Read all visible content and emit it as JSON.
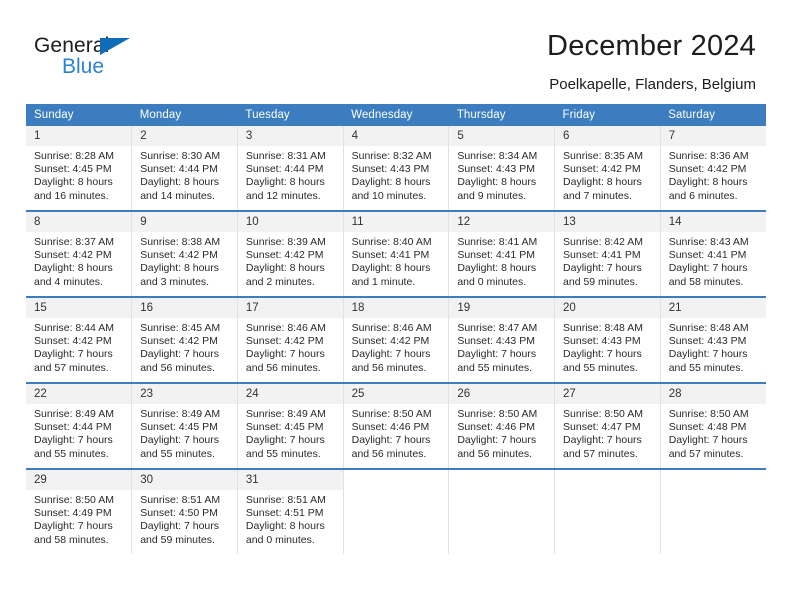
{
  "logo": {
    "text_primary": "General",
    "text_secondary": "Blue",
    "color_primary": "#1d1d1b",
    "color_secondary": "#2b82d4",
    "triangle_color": "#0f6cb8"
  },
  "header": {
    "title": "December 2024",
    "subtitle": "Poelkapelle, Flanders, Belgium"
  },
  "theme": {
    "header_bg": "#3b7dbf",
    "header_text": "#ffffff",
    "daynum_bg": "#f2f2f2",
    "cell_bg": "#ffffff",
    "text": "#2a2a2a"
  },
  "calendar": {
    "weekday_headers": [
      "Sunday",
      "Monday",
      "Tuesday",
      "Wednesday",
      "Thursday",
      "Friday",
      "Saturday"
    ],
    "weeks": [
      [
        {
          "day": "1",
          "sunrise": "Sunrise: 8:28 AM",
          "sunset": "Sunset: 4:45 PM",
          "daylight1": "Daylight: 8 hours",
          "daylight2": "and 16 minutes."
        },
        {
          "day": "2",
          "sunrise": "Sunrise: 8:30 AM",
          "sunset": "Sunset: 4:44 PM",
          "daylight1": "Daylight: 8 hours",
          "daylight2": "and 14 minutes."
        },
        {
          "day": "3",
          "sunrise": "Sunrise: 8:31 AM",
          "sunset": "Sunset: 4:44 PM",
          "daylight1": "Daylight: 8 hours",
          "daylight2": "and 12 minutes."
        },
        {
          "day": "4",
          "sunrise": "Sunrise: 8:32 AM",
          "sunset": "Sunset: 4:43 PM",
          "daylight1": "Daylight: 8 hours",
          "daylight2": "and 10 minutes."
        },
        {
          "day": "5",
          "sunrise": "Sunrise: 8:34 AM",
          "sunset": "Sunset: 4:43 PM",
          "daylight1": "Daylight: 8 hours",
          "daylight2": "and 9 minutes."
        },
        {
          "day": "6",
          "sunrise": "Sunrise: 8:35 AM",
          "sunset": "Sunset: 4:42 PM",
          "daylight1": "Daylight: 8 hours",
          "daylight2": "and 7 minutes."
        },
        {
          "day": "7",
          "sunrise": "Sunrise: 8:36 AM",
          "sunset": "Sunset: 4:42 PM",
          "daylight1": "Daylight: 8 hours",
          "daylight2": "and 6 minutes."
        }
      ],
      [
        {
          "day": "8",
          "sunrise": "Sunrise: 8:37 AM",
          "sunset": "Sunset: 4:42 PM",
          "daylight1": "Daylight: 8 hours",
          "daylight2": "and 4 minutes."
        },
        {
          "day": "9",
          "sunrise": "Sunrise: 8:38 AM",
          "sunset": "Sunset: 4:42 PM",
          "daylight1": "Daylight: 8 hours",
          "daylight2": "and 3 minutes."
        },
        {
          "day": "10",
          "sunrise": "Sunrise: 8:39 AM",
          "sunset": "Sunset: 4:42 PM",
          "daylight1": "Daylight: 8 hours",
          "daylight2": "and 2 minutes."
        },
        {
          "day": "11",
          "sunrise": "Sunrise: 8:40 AM",
          "sunset": "Sunset: 4:41 PM",
          "daylight1": "Daylight: 8 hours",
          "daylight2": "and 1 minute."
        },
        {
          "day": "12",
          "sunrise": "Sunrise: 8:41 AM",
          "sunset": "Sunset: 4:41 PM",
          "daylight1": "Daylight: 8 hours",
          "daylight2": "and 0 minutes."
        },
        {
          "day": "13",
          "sunrise": "Sunrise: 8:42 AM",
          "sunset": "Sunset: 4:41 PM",
          "daylight1": "Daylight: 7 hours",
          "daylight2": "and 59 minutes."
        },
        {
          "day": "14",
          "sunrise": "Sunrise: 8:43 AM",
          "sunset": "Sunset: 4:41 PM",
          "daylight1": "Daylight: 7 hours",
          "daylight2": "and 58 minutes."
        }
      ],
      [
        {
          "day": "15",
          "sunrise": "Sunrise: 8:44 AM",
          "sunset": "Sunset: 4:42 PM",
          "daylight1": "Daylight: 7 hours",
          "daylight2": "and 57 minutes."
        },
        {
          "day": "16",
          "sunrise": "Sunrise: 8:45 AM",
          "sunset": "Sunset: 4:42 PM",
          "daylight1": "Daylight: 7 hours",
          "daylight2": "and 56 minutes."
        },
        {
          "day": "17",
          "sunrise": "Sunrise: 8:46 AM",
          "sunset": "Sunset: 4:42 PM",
          "daylight1": "Daylight: 7 hours",
          "daylight2": "and 56 minutes."
        },
        {
          "day": "18",
          "sunrise": "Sunrise: 8:46 AM",
          "sunset": "Sunset: 4:42 PM",
          "daylight1": "Daylight: 7 hours",
          "daylight2": "and 56 minutes."
        },
        {
          "day": "19",
          "sunrise": "Sunrise: 8:47 AM",
          "sunset": "Sunset: 4:43 PM",
          "daylight1": "Daylight: 7 hours",
          "daylight2": "and 55 minutes."
        },
        {
          "day": "20",
          "sunrise": "Sunrise: 8:48 AM",
          "sunset": "Sunset: 4:43 PM",
          "daylight1": "Daylight: 7 hours",
          "daylight2": "and 55 minutes."
        },
        {
          "day": "21",
          "sunrise": "Sunrise: 8:48 AM",
          "sunset": "Sunset: 4:43 PM",
          "daylight1": "Daylight: 7 hours",
          "daylight2": "and 55 minutes."
        }
      ],
      [
        {
          "day": "22",
          "sunrise": "Sunrise: 8:49 AM",
          "sunset": "Sunset: 4:44 PM",
          "daylight1": "Daylight: 7 hours",
          "daylight2": "and 55 minutes."
        },
        {
          "day": "23",
          "sunrise": "Sunrise: 8:49 AM",
          "sunset": "Sunset: 4:45 PM",
          "daylight1": "Daylight: 7 hours",
          "daylight2": "and 55 minutes."
        },
        {
          "day": "24",
          "sunrise": "Sunrise: 8:49 AM",
          "sunset": "Sunset: 4:45 PM",
          "daylight1": "Daylight: 7 hours",
          "daylight2": "and 55 minutes."
        },
        {
          "day": "25",
          "sunrise": "Sunrise: 8:50 AM",
          "sunset": "Sunset: 4:46 PM",
          "daylight1": "Daylight: 7 hours",
          "daylight2": "and 56 minutes."
        },
        {
          "day": "26",
          "sunrise": "Sunrise: 8:50 AM",
          "sunset": "Sunset: 4:46 PM",
          "daylight1": "Daylight: 7 hours",
          "daylight2": "and 56 minutes."
        },
        {
          "day": "27",
          "sunrise": "Sunrise: 8:50 AM",
          "sunset": "Sunset: 4:47 PM",
          "daylight1": "Daylight: 7 hours",
          "daylight2": "and 57 minutes."
        },
        {
          "day": "28",
          "sunrise": "Sunrise: 8:50 AM",
          "sunset": "Sunset: 4:48 PM",
          "daylight1": "Daylight: 7 hours",
          "daylight2": "and 57 minutes."
        }
      ],
      [
        {
          "day": "29",
          "sunrise": "Sunrise: 8:50 AM",
          "sunset": "Sunset: 4:49 PM",
          "daylight1": "Daylight: 7 hours",
          "daylight2": "and 58 minutes."
        },
        {
          "day": "30",
          "sunrise": "Sunrise: 8:51 AM",
          "sunset": "Sunset: 4:50 PM",
          "daylight1": "Daylight: 7 hours",
          "daylight2": "and 59 minutes."
        },
        {
          "day": "31",
          "sunrise": "Sunrise: 8:51 AM",
          "sunset": "Sunset: 4:51 PM",
          "daylight1": "Daylight: 8 hours",
          "daylight2": "and 0 minutes."
        },
        {
          "day": "",
          "sunrise": "",
          "sunset": "",
          "daylight1": "",
          "daylight2": ""
        },
        {
          "day": "",
          "sunrise": "",
          "sunset": "",
          "daylight1": "",
          "daylight2": ""
        },
        {
          "day": "",
          "sunrise": "",
          "sunset": "",
          "daylight1": "",
          "daylight2": ""
        },
        {
          "day": "",
          "sunrise": "",
          "sunset": "",
          "daylight1": "",
          "daylight2": ""
        }
      ]
    ]
  }
}
